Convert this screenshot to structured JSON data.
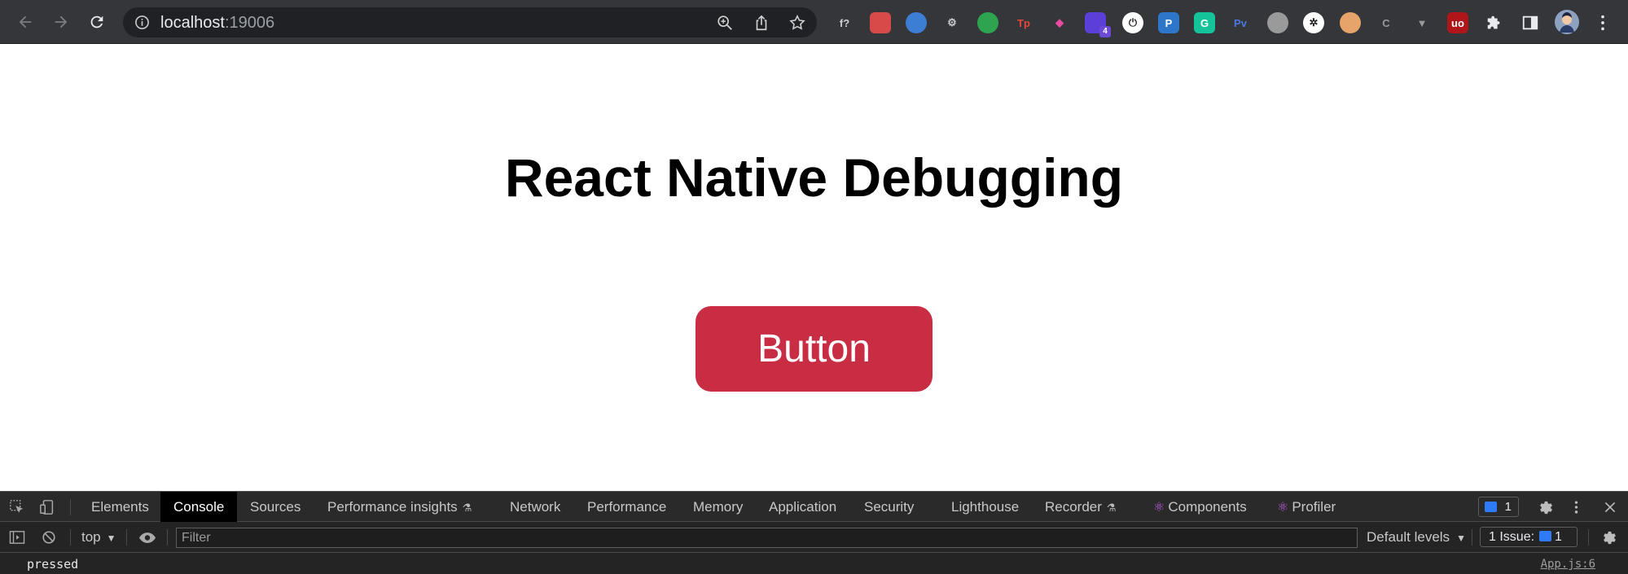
{
  "browser": {
    "url_host": "localhost",
    "url_port": ":19006",
    "extensions": [
      {
        "name": "formula-ext",
        "glyph": "f?",
        "bg": "transparent",
        "fg": "#d0d0d0"
      },
      {
        "name": "red-ext",
        "glyph": "",
        "bg": "#d84a4a",
        "fg": "#ffffff"
      },
      {
        "name": "blue-circle-ext",
        "glyph": "",
        "bg": "#3c7ed3",
        "fg": "#ffffff"
      },
      {
        "name": "gear-ext",
        "glyph": "⚙",
        "bg": "transparent",
        "fg": "#c8c8c8"
      },
      {
        "name": "green-ext",
        "glyph": "",
        "bg": "#2ea44f",
        "fg": "#ffffff"
      },
      {
        "name": "tp-ext",
        "glyph": "Tp",
        "bg": "transparent",
        "fg": "#e8453c"
      },
      {
        "name": "color-ext",
        "glyph": "◆",
        "bg": "transparent",
        "fg": "#e84ca0"
      },
      {
        "name": "stack-ext",
        "glyph": "",
        "bg": "#5b3fd8",
        "fg": "#ffffff",
        "badge": "4"
      },
      {
        "name": "power-ext",
        "glyph": "⏻",
        "bg": "#ffffff",
        "fg": "#333333"
      },
      {
        "name": "p-ext",
        "glyph": "P",
        "bg": "#2d76c9",
        "fg": "#ffffff"
      },
      {
        "name": "grammarly-ext",
        "glyph": "G",
        "bg": "#15c39a",
        "fg": "#ffffff"
      },
      {
        "name": "pv-ext",
        "glyph": "Pv",
        "bg": "transparent",
        "fg": "#4a78e0"
      },
      {
        "name": "gray-circle-ext",
        "glyph": "",
        "bg": "#9a9a9a",
        "fg": "#ffffff"
      },
      {
        "name": "openai-ext",
        "glyph": "✲",
        "bg": "#ffffff",
        "fg": "#202124"
      },
      {
        "name": "owl-ext",
        "glyph": "",
        "bg": "#e6a36a",
        "fg": "#ffffff"
      },
      {
        "name": "c-ext",
        "glyph": "C",
        "bg": "transparent",
        "fg": "#9a9a9a"
      },
      {
        "name": "v-ext",
        "glyph": "▼",
        "bg": "transparent",
        "fg": "#9a9a9a"
      },
      {
        "name": "ublock-ext",
        "glyph": "uo",
        "bg": "#b0151a",
        "fg": "#ffffff"
      }
    ]
  },
  "page": {
    "title": "React Native Debugging",
    "button_label": "Button"
  },
  "devtools": {
    "tabs": [
      {
        "label": "Elements"
      },
      {
        "label": "Console",
        "active": true
      },
      {
        "label": "Sources"
      },
      {
        "label": "Performance insights",
        "experimental": true
      },
      {
        "label": "Network"
      },
      {
        "label": "Performance"
      },
      {
        "label": "Memory"
      },
      {
        "label": "Application"
      },
      {
        "label": "Security"
      },
      {
        "label": "Lighthouse"
      },
      {
        "label": "Recorder",
        "experimental": true
      },
      {
        "label": "Components",
        "react": true
      },
      {
        "label": "Profiler",
        "react": true
      }
    ],
    "message_count": "1",
    "context": "top",
    "filter_placeholder": "Filter",
    "levels_label": "Default levels",
    "issues_label": "1 Issue:",
    "issues_count": "1",
    "console": {
      "message": "pressed",
      "source": "App.js:6"
    }
  },
  "colors": {
    "button_bg": "#c92d43",
    "toolbar_bg": "#35363a",
    "devtools_bg": "#242424"
  }
}
